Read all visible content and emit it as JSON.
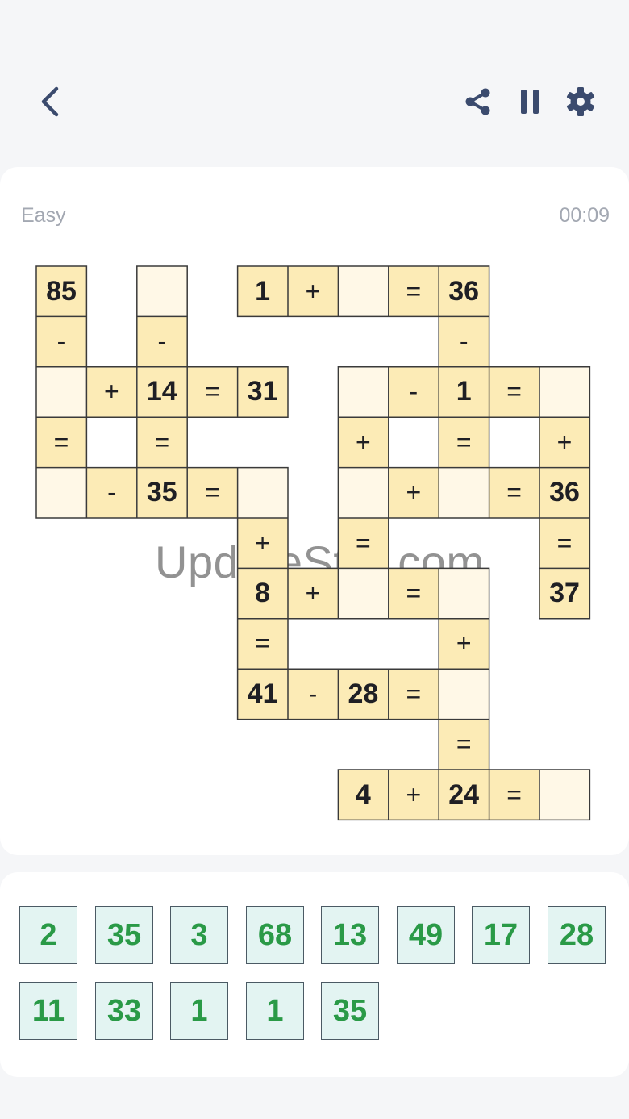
{
  "header": {
    "back_icon": "chevron-left-icon",
    "share_icon": "share-icon",
    "pause_icon": "pause-icon",
    "settings_icon": "gear-icon",
    "icon_color": "#3b4b6e"
  },
  "status": {
    "difficulty": "Easy",
    "timer": "00:09"
  },
  "watermark": "UpdateStar.com",
  "colors": {
    "filled_cell": "#fcebb6",
    "empty_cell": "#fff8e7",
    "tile_bg": "#e3f4f2",
    "tile_text": "#2a9a47"
  },
  "grid": {
    "cells": [
      {
        "row": 0,
        "col": 0,
        "value": "85"
      },
      {
        "row": 0,
        "col": 2,
        "value": ""
      },
      {
        "row": 0,
        "col": 4,
        "value": "1"
      },
      {
        "row": 0,
        "col": 5,
        "value": "+"
      },
      {
        "row": 0,
        "col": 6,
        "value": ""
      },
      {
        "row": 0,
        "col": 7,
        "value": "="
      },
      {
        "row": 0,
        "col": 8,
        "value": "36"
      },
      {
        "row": 1,
        "col": 0,
        "value": "-"
      },
      {
        "row": 1,
        "col": 2,
        "value": "-"
      },
      {
        "row": 1,
        "col": 8,
        "value": "-"
      },
      {
        "row": 2,
        "col": 0,
        "value": ""
      },
      {
        "row": 2,
        "col": 1,
        "value": "+"
      },
      {
        "row": 2,
        "col": 2,
        "value": "14"
      },
      {
        "row": 2,
        "col": 3,
        "value": "="
      },
      {
        "row": 2,
        "col": 4,
        "value": "31"
      },
      {
        "row": 2,
        "col": 6,
        "value": ""
      },
      {
        "row": 2,
        "col": 7,
        "value": "-"
      },
      {
        "row": 2,
        "col": 8,
        "value": "1"
      },
      {
        "row": 2,
        "col": 9,
        "value": "="
      },
      {
        "row": 2,
        "col": 10,
        "value": ""
      },
      {
        "row": 3,
        "col": 0,
        "value": "="
      },
      {
        "row": 3,
        "col": 2,
        "value": "="
      },
      {
        "row": 3,
        "col": 6,
        "value": "+"
      },
      {
        "row": 3,
        "col": 8,
        "value": "="
      },
      {
        "row": 3,
        "col": 10,
        "value": "+"
      },
      {
        "row": 4,
        "col": 0,
        "value": ""
      },
      {
        "row": 4,
        "col": 1,
        "value": "-"
      },
      {
        "row": 4,
        "col": 2,
        "value": "35"
      },
      {
        "row": 4,
        "col": 3,
        "value": "="
      },
      {
        "row": 4,
        "col": 4,
        "value": ""
      },
      {
        "row": 4,
        "col": 6,
        "value": ""
      },
      {
        "row": 4,
        "col": 7,
        "value": "+"
      },
      {
        "row": 4,
        "col": 8,
        "value": ""
      },
      {
        "row": 4,
        "col": 9,
        "value": "="
      },
      {
        "row": 4,
        "col": 10,
        "value": "36"
      },
      {
        "row": 5,
        "col": 4,
        "value": "+"
      },
      {
        "row": 5,
        "col": 6,
        "value": "="
      },
      {
        "row": 5,
        "col": 10,
        "value": "="
      },
      {
        "row": 6,
        "col": 4,
        "value": "8"
      },
      {
        "row": 6,
        "col": 5,
        "value": "+"
      },
      {
        "row": 6,
        "col": 6,
        "value": ""
      },
      {
        "row": 6,
        "col": 7,
        "value": "="
      },
      {
        "row": 6,
        "col": 8,
        "value": ""
      },
      {
        "row": 6,
        "col": 10,
        "value": "37"
      },
      {
        "row": 7,
        "col": 4,
        "value": "="
      },
      {
        "row": 7,
        "col": 8,
        "value": "+"
      },
      {
        "row": 8,
        "col": 4,
        "value": "41"
      },
      {
        "row": 8,
        "col": 5,
        "value": "-"
      },
      {
        "row": 8,
        "col": 6,
        "value": "28"
      },
      {
        "row": 8,
        "col": 7,
        "value": "="
      },
      {
        "row": 8,
        "col": 8,
        "value": ""
      },
      {
        "row": 9,
        "col": 8,
        "value": "="
      },
      {
        "row": 10,
        "col": 6,
        "value": "4"
      },
      {
        "row": 10,
        "col": 7,
        "value": "+"
      },
      {
        "row": 10,
        "col": 8,
        "value": "24"
      },
      {
        "row": 10,
        "col": 9,
        "value": "="
      },
      {
        "row": 10,
        "col": 10,
        "value": ""
      }
    ]
  },
  "tray": {
    "tiles": [
      "2",
      "35",
      "3",
      "68",
      "13",
      "49",
      "17",
      "28",
      "11",
      "33",
      "1",
      "1",
      "35"
    ]
  }
}
